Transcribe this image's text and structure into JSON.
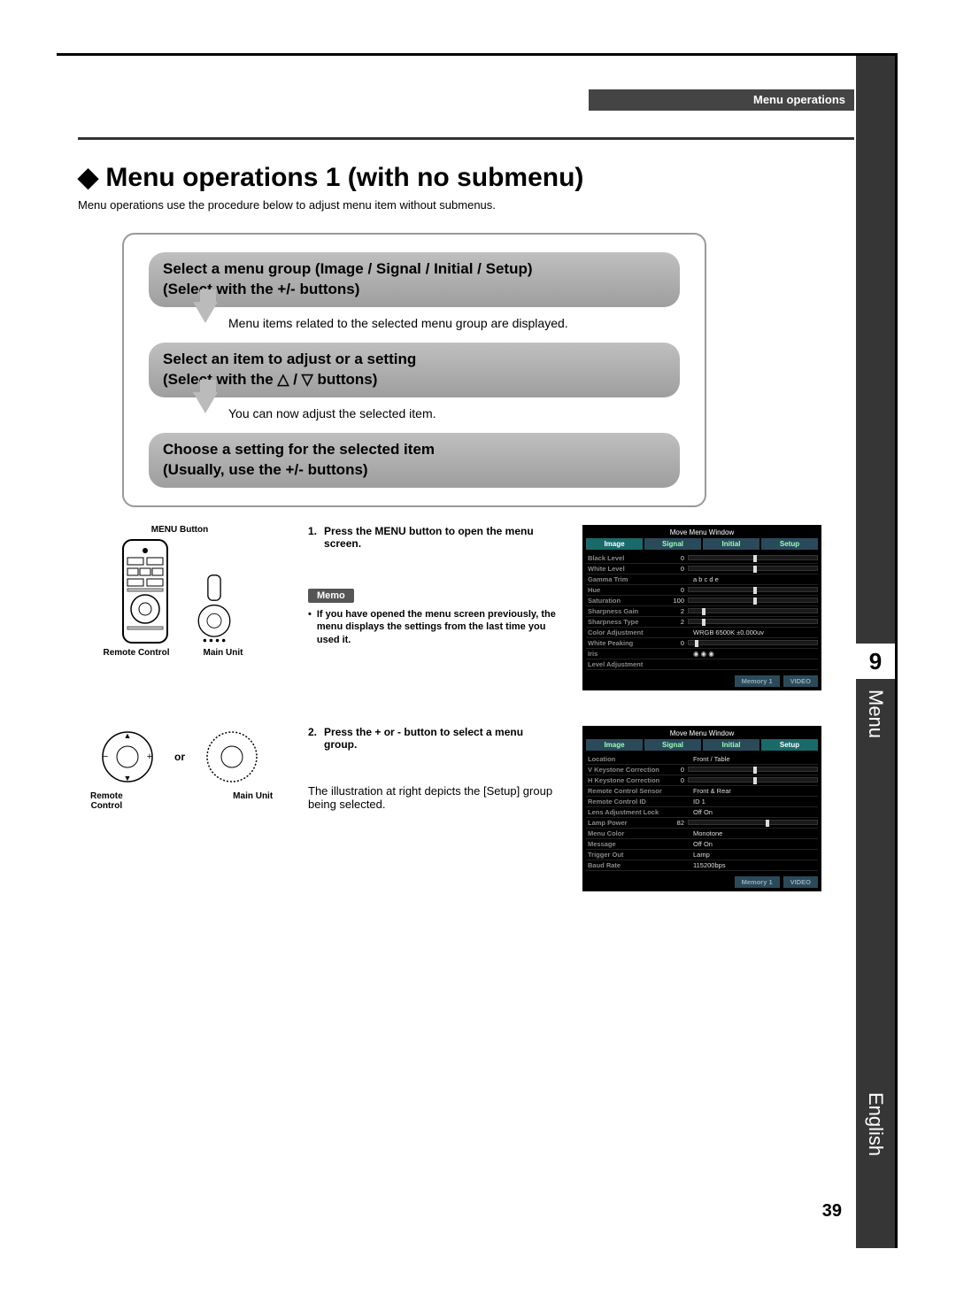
{
  "header": {
    "breadcrumb": "Menu operations"
  },
  "sideTab": {
    "number": "9",
    "label": "Menu",
    "language": "English"
  },
  "pageNumber": "39",
  "title": "Menu operations 1 (with no submenu)",
  "intro": "Menu operations use the procedure below to adjust menu item without submenus.",
  "flow": {
    "step1_line1": "Select a menu group (Image / Signal / Initial / Setup)",
    "step1_line2": "(Select with the +/- buttons)",
    "step1_desc": "Menu items related to the selected menu group are displayed.",
    "step2_line1": "Select an item to adjust or a setting",
    "step2_line2": "(Select with the △ / ▽ buttons)",
    "step2_desc": "You can now adjust the selected item.",
    "step3_line1": "Choose a setting for the selected item",
    "step3_line2": "(Usually, use the +/- buttons)"
  },
  "labels": {
    "menuButton": "MENU Button",
    "remoteControl": "Remote Control",
    "mainUnit": "Main Unit",
    "memo": "Memo",
    "or": "or"
  },
  "proc": {
    "s1_num": "1.",
    "s1_text": "Press the MENU button to open the menu screen.",
    "memo_text": "If you have opened the menu screen previously, the menu displays the settings from the last time you used it.",
    "s2_num": "2.",
    "s2_text": "Press the + or - button to select a menu group.",
    "s2_body": "The illustration at right depicts the [Setup] group being selected."
  },
  "menu1": {
    "title": "Move Menu Window",
    "tabs": [
      "Image",
      "Signal",
      "Initial",
      "Setup"
    ],
    "active": 0,
    "rows": [
      {
        "label": "Black Level",
        "val": "0",
        "knob": 50
      },
      {
        "label": "White Level",
        "val": "0",
        "knob": 50
      },
      {
        "label": "Gamma Trim",
        "val": "",
        "text": "a    b    c    d    e"
      },
      {
        "label": "Hue",
        "val": "0",
        "knob": 50
      },
      {
        "label": "Saturation",
        "val": "100",
        "knob": 50
      },
      {
        "label": "Sharpness Gain",
        "val": "2",
        "knob": 10
      },
      {
        "label": "Sharpness Type",
        "val": "2",
        "knob": 10
      },
      {
        "label": "Color Adjustment",
        "val": "",
        "text": "WRGB        6500K ±0.000uv"
      },
      {
        "label": "White Peaking",
        "val": "0",
        "knob": 5
      },
      {
        "label": "Iris",
        "val": "",
        "text": "◉        ◉        ◉"
      },
      {
        "label": "Level Adjustment",
        "val": "",
        "text": ""
      }
    ],
    "footer": [
      "Memory 1",
      "VIDEO"
    ]
  },
  "menu2": {
    "title": "Move Menu Window",
    "tabs": [
      "Image",
      "Signal",
      "Initial",
      "Setup"
    ],
    "active": 3,
    "rows": [
      {
        "label": "Location",
        "val": "",
        "text": "Front / Table"
      },
      {
        "label": "V Keystone Correction",
        "val": "0",
        "knob": 50
      },
      {
        "label": "H Keystone Correction",
        "val": "0",
        "knob": 50
      },
      {
        "label": "Remote Control Sensor",
        "val": "",
        "text": "Front & Rear"
      },
      {
        "label": "Remote Control ID",
        "val": "",
        "text": "ID 1"
      },
      {
        "label": "Lens Adjustment Lock",
        "val": "",
        "text": "Off          On"
      },
      {
        "label": "Lamp Power",
        "val": "82",
        "knob": 60
      },
      {
        "label": "Menu Color",
        "val": "",
        "text": "Monotone"
      },
      {
        "label": "Message",
        "val": "",
        "text": "Off          On"
      },
      {
        "label": "Trigger Out",
        "val": "",
        "text": "Lamp"
      },
      {
        "label": "Baud Rate",
        "val": "",
        "text": "115200bps"
      }
    ],
    "footer": [
      "Memory 1",
      "VIDEO"
    ]
  }
}
